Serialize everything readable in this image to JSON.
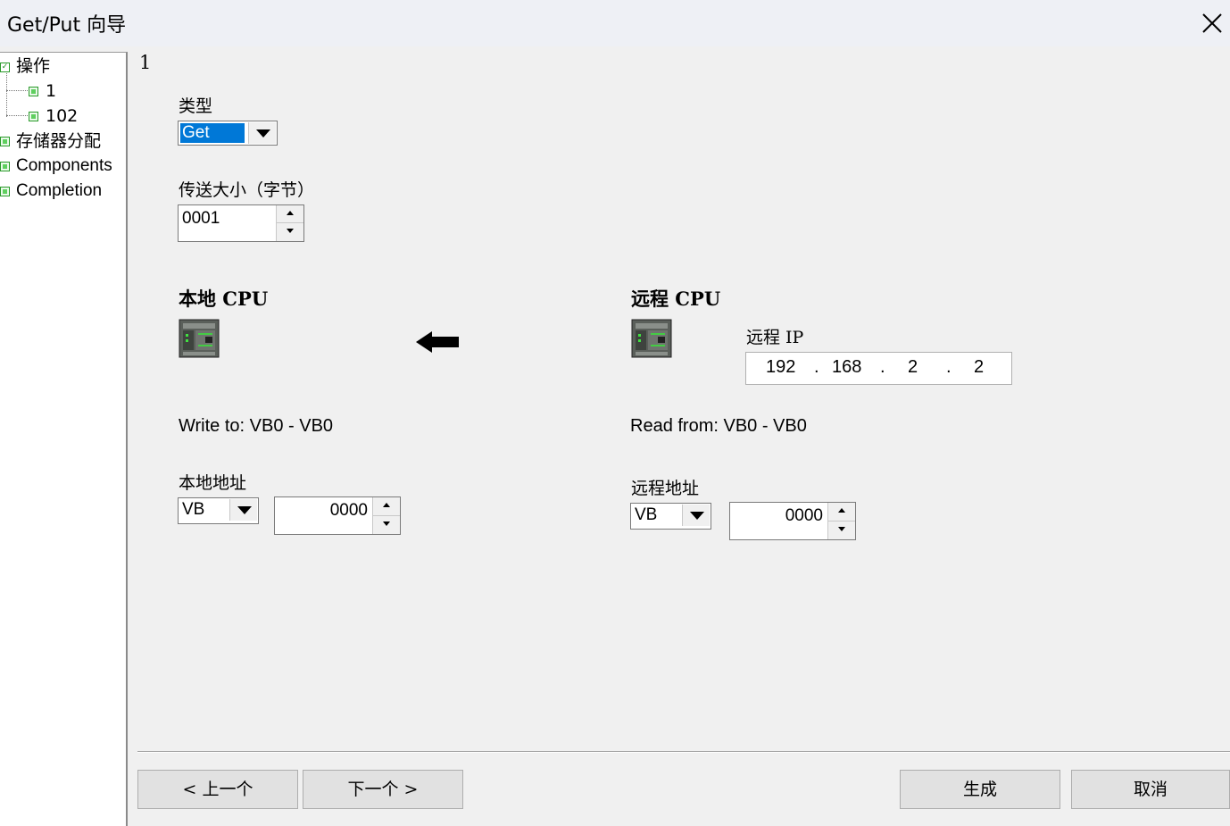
{
  "window": {
    "title": "Get/Put 向导"
  },
  "tree": {
    "items": [
      {
        "label": "操作"
      },
      {
        "label": "1"
      },
      {
        "label": "102"
      },
      {
        "label": "存储器分配"
      },
      {
        "label": "Components"
      },
      {
        "label": "Completion"
      }
    ]
  },
  "page": {
    "number": "1",
    "type_label": "类型",
    "type_value": "Get",
    "size_label": "传送大小（字节）",
    "size_value": "0001",
    "local": {
      "heading": "本地  CPU",
      "summary": "Write to: VB0 - VB0",
      "address_label": "本地地址",
      "area_value": "VB",
      "offset_value": "0000",
      "icon": "plc-cpu-icon"
    },
    "remote": {
      "heading": "远程  CPU",
      "ip_label": "远程 IP",
      "ip_octets": [
        "192",
        "168",
        "2",
        "2"
      ],
      "summary": "Read from: VB0 - VB0",
      "address_label": "远程地址",
      "area_value": "VB",
      "offset_value": "0000",
      "icon": "plc-cpu-icon"
    },
    "direction_icon": "arrow-left-icon"
  },
  "buttons": {
    "prev": "< 上一个",
    "next": "下一个 >",
    "generate": "生成",
    "cancel": "取消"
  },
  "colors": {
    "selection": "#0078d7",
    "tree_box": "#2a9a2a",
    "background": "#f0f0f0"
  }
}
